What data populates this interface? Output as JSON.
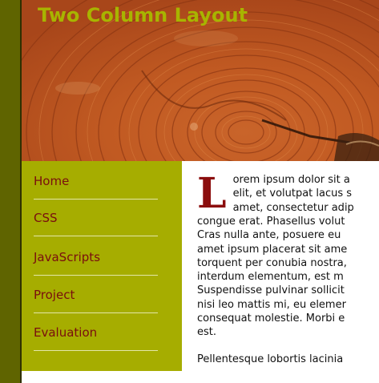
{
  "header": {
    "title": "Two Column Layout",
    "image": "wood-tree-rings"
  },
  "nav": {
    "items": [
      {
        "label": "Home"
      },
      {
        "label": "CSS"
      },
      {
        "label": "JavaScripts"
      },
      {
        "label": "Project"
      },
      {
        "label": "Evaluation"
      }
    ]
  },
  "content": {
    "drop_cap": "L",
    "paragraph1_lines": [
      "orem ipsum dolor sit a",
      "elit, et volutpat lacus s",
      "amet, consectetur adip",
      "congue erat. Phasellus volut",
      "Cras nulla ante, posuere eu",
      "amet ipsum placerat sit ame",
      "torquent per conubia nostra,",
      "interdum elementum, est m",
      "Suspendisse pulvinar sollicit",
      "nisi leo mattis mi, eu elemer",
      "consequat molestie. Morbi e",
      "est."
    ],
    "paragraph2_first_line": "Pellentesque lobortis lacinia"
  },
  "colors": {
    "left_strip": "#5f6400",
    "sidebar_bg": "#a6ad00",
    "nav_text": "#7a0e0e",
    "title_text": "#a8b400",
    "drop_cap": "#8b0d0d"
  }
}
